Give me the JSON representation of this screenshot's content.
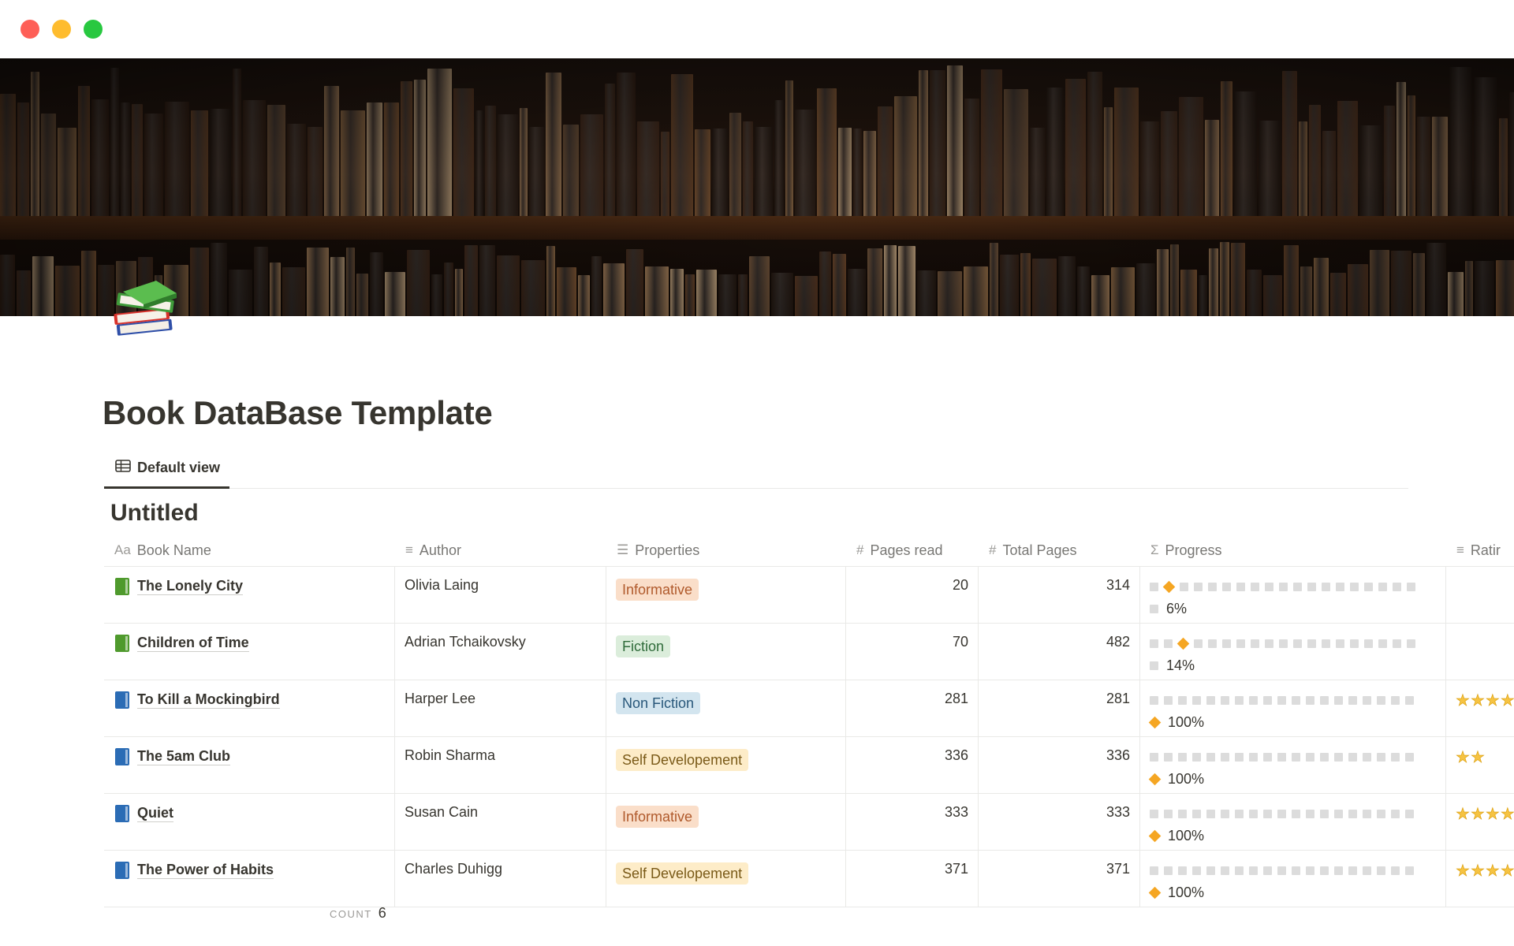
{
  "window": {
    "controls": [
      "close",
      "minimize",
      "zoom"
    ]
  },
  "page": {
    "icon": "books-icon",
    "title": "Book DataBase Template"
  },
  "views": [
    {
      "label": "Default view",
      "icon": "table-icon",
      "active": true
    }
  ],
  "database": {
    "title": "Untitled",
    "columns": [
      {
        "icon_text": "Aa",
        "icon": "text-title-icon",
        "label": "Book Name"
      },
      {
        "icon_text": "≡",
        "icon": "text-lines-icon",
        "label": "Author"
      },
      {
        "icon_text": "☰",
        "icon": "multi-select-icon",
        "label": "Properties"
      },
      {
        "icon_text": "#",
        "icon": "number-icon",
        "label": "Pages read"
      },
      {
        "icon_text": "#",
        "icon": "number-icon",
        "label": "Total Pages"
      },
      {
        "icon_text": "Σ",
        "icon": "formula-icon",
        "label": "Progress"
      },
      {
        "icon_text": "≡",
        "icon": "text-lines-icon",
        "label": "Ratir"
      }
    ],
    "rows": [
      {
        "name": "The Lonely City",
        "book_icon": "green-book-icon",
        "author": "Olivia Laing",
        "property": "Informative",
        "tag_bg": "#fadec9",
        "tag_fg": "#b05a2c",
        "pages_read": "20",
        "total_pages": "314",
        "progress_fraction": 0.06,
        "progress_label": "6%",
        "rating": 0
      },
      {
        "name": "Children of Time",
        "book_icon": "green-book-icon",
        "author": "Adrian Tchaikovsky",
        "property": "Fiction",
        "tag_bg": "#dbeddb",
        "tag_fg": "#2f6b3a",
        "pages_read": "70",
        "total_pages": "482",
        "progress_fraction": 0.14,
        "progress_label": "14%",
        "rating": 0
      },
      {
        "name": "To Kill a Mockingbird",
        "book_icon": "blue-book-icon",
        "author": "Harper Lee",
        "property": "Non Fiction",
        "tag_bg": "#d3e5ef",
        "tag_fg": "#28577a",
        "pages_read": "281",
        "total_pages": "281",
        "progress_fraction": 1.0,
        "progress_label": "100%",
        "rating": 4
      },
      {
        "name": "The 5am Club",
        "book_icon": "blue-book-icon",
        "author": "Robin Sharma",
        "property": "Self Developement",
        "tag_bg": "#fdecc8",
        "tag_fg": "#7a5a18",
        "pages_read": "336",
        "total_pages": "336",
        "progress_fraction": 1.0,
        "progress_label": "100%",
        "rating": 2
      },
      {
        "name": "Quiet",
        "book_icon": "blue-book-icon",
        "author": "Susan Cain",
        "property": "Informative",
        "tag_bg": "#fadec9",
        "tag_fg": "#b05a2c",
        "pages_read": "333",
        "total_pages": "333",
        "progress_fraction": 1.0,
        "progress_label": "100%",
        "rating": 4
      },
      {
        "name": "The Power of Habits",
        "book_icon": "blue-book-icon",
        "author": "Charles Duhigg",
        "property": "Self Developement",
        "tag_bg": "#fdecc8",
        "tag_fg": "#7a5a18",
        "pages_read": "371",
        "total_pages": "371",
        "progress_fraction": 1.0,
        "progress_label": "100%",
        "rating": 4
      }
    ],
    "footer": {
      "count_label": "COUNT",
      "count_value": "6"
    }
  },
  "colors": {
    "progress_marker": "#f5a623",
    "progress_empty": "#dcdcdc",
    "star": "#f6c342"
  }
}
